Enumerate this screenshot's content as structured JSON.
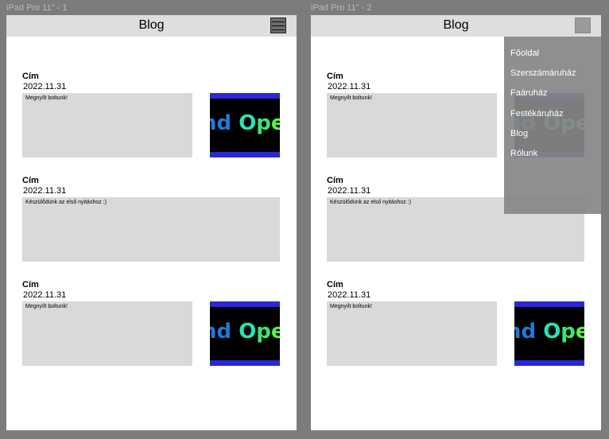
{
  "frames": [
    {
      "label": "iPad Pro 11\" - 1",
      "header_title": "Blog",
      "posts": [
        {
          "title": "Cím",
          "date": "2022.11.31",
          "text": "Megnyílt boltunk!",
          "image_text": "nd Ope"
        },
        {
          "title": "Cím",
          "date": "2022.11.31",
          "text": "Készülődünk az első nyitáshoz :)"
        },
        {
          "title": "Cím",
          "date": "2022.11.31",
          "text": "Megnyílt boltunk!",
          "image_text": "nd Ope"
        }
      ]
    },
    {
      "label": "iPad Pro 11\" - 2",
      "header_title": "Blog",
      "posts": [
        {
          "title": "Cím",
          "date": "2022.11.31",
          "text": "Megnyílt boltunk!",
          "image_text": "nd Ope"
        },
        {
          "title": "Cím",
          "date": "2022.11.31",
          "text": "Készülődünk az első nyitáshoz :)"
        },
        {
          "title": "Cím",
          "date": "2022.11.31",
          "text": "Megnyílt boltunk!",
          "image_text": "nd Ope"
        }
      ],
      "menu_items": [
        "Főoldal",
        "Szerszámáruház",
        "Faáruház",
        "Festékáruház",
        "Blog",
        "Rólunk"
      ]
    }
  ],
  "icons": {
    "menu": "hamburger-menu-icon"
  },
  "colors": {
    "background": "#7c7c7c",
    "header": "#dedede",
    "post_box": "#d9d9d9",
    "image_band": "#2a27d8",
    "menu_overlay": "#878787"
  }
}
